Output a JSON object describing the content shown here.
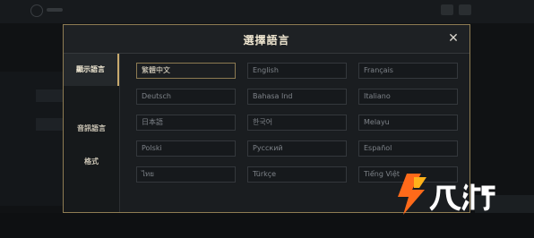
{
  "modal": {
    "title": "選擇語言",
    "close_label": "✕"
  },
  "sidebar": {
    "tabs": [
      {
        "label": "顯示語言",
        "active": true
      },
      {
        "label": "音訊語言",
        "active": false
      },
      {
        "label": "格式",
        "active": false
      }
    ]
  },
  "languages": [
    [
      "繁體中文",
      "English",
      "Français"
    ],
    [
      "Deutsch",
      "Bahasa Ind",
      "Italiano"
    ],
    [
      "日本語",
      "한국어",
      "Melayu"
    ],
    [
      "Polski",
      "Русский",
      "Español"
    ],
    [
      "ไทย",
      "Türkçe",
      "Tiếng Việt"
    ]
  ],
  "selected_language": "繁體中文",
  "watermark": {
    "text": "九游",
    "icon": "nine-game-logo-icon"
  },
  "colors": {
    "accent_gold": "#c8aa6e",
    "border_gold": "#8e7c53",
    "logo_orange": "#ff6a1a"
  }
}
